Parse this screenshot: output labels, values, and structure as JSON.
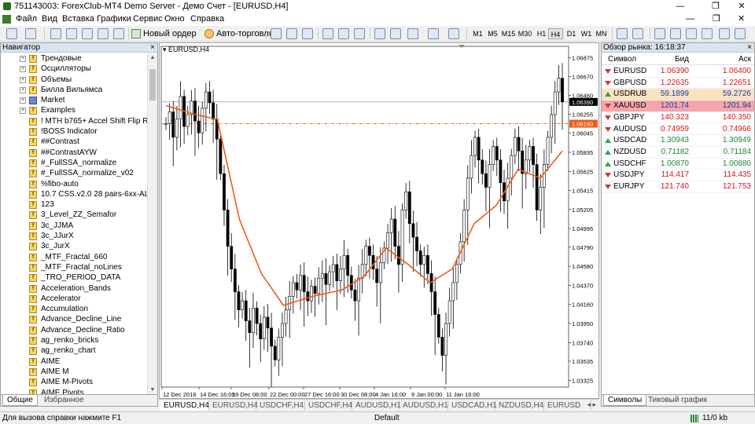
{
  "window": {
    "title": "751143003: ForexClub-MT4 Demo Server - Демо Счет - [EURUSD,H4]",
    "minimize": "—",
    "maximize": "❐",
    "close": "✕"
  },
  "menu": {
    "items": [
      "Файл",
      "Вид",
      "Вставка",
      "Графики",
      "Сервис",
      "Окно",
      "Справка"
    ],
    "mdi_minimize": "—",
    "mdi_restore": "❐",
    "mdi_close": "✕"
  },
  "toolbar": {
    "new_order": "Новый ордер",
    "auto_trading": "Авто-торговля",
    "timeframes": [
      "M1",
      "M5",
      "M15",
      "M30",
      "H1",
      "H4",
      "D1",
      "W1",
      "MN"
    ],
    "active_timeframe": "H4"
  },
  "navigator": {
    "title": "Навигатор",
    "close": "×",
    "items": [
      {
        "label": "Трендовые",
        "type": "folder"
      },
      {
        "label": "Осцилляторы",
        "type": "folder"
      },
      {
        "label": "Объемы",
        "type": "folder"
      },
      {
        "label": "Билла Вильямса",
        "type": "folder"
      },
      {
        "label": "Market",
        "type": "market"
      },
      {
        "label": "Examples",
        "type": "folder"
      },
      {
        "label": "!   MTH b765+ Accel Shift Flip Renko",
        "type": "indicator"
      },
      {
        "label": "!BOSS Indicator",
        "type": "indicator"
      },
      {
        "label": "##Contrast",
        "type": "indicator"
      },
      {
        "label": "##ContrastAYW",
        "type": "indicator"
      },
      {
        "label": "#_FullSSA_normalize",
        "type": "indicator"
      },
      {
        "label": "#_FullSSA_normalize_v02",
        "type": "indicator"
      },
      {
        "label": "%fibo-auto",
        "type": "indicator"
      },
      {
        "label": "10.7 CSS.v2.0 28 pairs-6xx-ALL",
        "type": "indicator"
      },
      {
        "label": "123",
        "type": "indicator"
      },
      {
        "label": "3_Level_ZZ_Semafor",
        "type": "indicator"
      },
      {
        "label": "3c_JJMA",
        "type": "indicator"
      },
      {
        "label": "3c_JJurX",
        "type": "indicator"
      },
      {
        "label": "3c_JurX",
        "type": "indicator"
      },
      {
        "label": "_MTF_Fractal_660",
        "type": "indicator"
      },
      {
        "label": "_MTF_Fractal_noLines",
        "type": "indicator"
      },
      {
        "label": "_TRO_PERIOD_DATA",
        "type": "indicator"
      },
      {
        "label": "Acceleration_Bands",
        "type": "indicator"
      },
      {
        "label": "Accelerator",
        "type": "indicator"
      },
      {
        "label": "Accumulation",
        "type": "indicator"
      },
      {
        "label": "Advance_Decline_Line",
        "type": "indicator"
      },
      {
        "label": "Advance_Decline_Ratio",
        "type": "indicator"
      },
      {
        "label": "ag_renko_bricks",
        "type": "indicator"
      },
      {
        "label": "ag_renko_chart",
        "type": "indicator"
      },
      {
        "label": "AIME",
        "type": "indicator"
      },
      {
        "label": "AIME M",
        "type": "indicator"
      },
      {
        "label": "AIME M-Pivots",
        "type": "indicator"
      },
      {
        "label": "AIME Pivots",
        "type": "indicator"
      }
    ],
    "tabs": [
      "Общие",
      "Избранное"
    ]
  },
  "chart": {
    "title": "EURUSD,H4",
    "bid_line_label": "1.06390",
    "ask_line_label": "1.06150",
    "price_labels": [
      "1.06875",
      "1.06670",
      "1.06460",
      "1.06255",
      "1.06045",
      "1.05835",
      "1.05625",
      "1.05415",
      "1.05205",
      "1.04995",
      "1.04790",
      "1.04580",
      "1.04370",
      "1.04160",
      "1.03950",
      "1.03740",
      "1.03535",
      "1.03325"
    ],
    "time_labels": [
      "12 Dec 2016",
      "14 Dec 16:00",
      "19 Dec 08:00",
      "22 Dec 00:00",
      "27 Dec 16:00",
      "30 Dec 08:00",
      "4 Jan 16:00",
      "9 Jan 00:00",
      "11 Jan 16:00"
    ],
    "tabs": [
      "EURUSD,H4",
      "EURUSD,H4",
      "USDCHF,H4",
      "USDCHF,H4",
      "AUDUSD,H1",
      "AUDUSD,H1",
      "USDCAD,H1",
      "NZDUSD,H4",
      "EURUSD"
    ]
  },
  "chart_data": {
    "type": "candlestick",
    "symbol": "EURUSD",
    "timeframe": "H4",
    "ylim": [
      1.0325,
      1.0695
    ],
    "closes": [
      1.0615,
      1.0628,
      1.06,
      1.062,
      1.0645,
      1.0612,
      1.0625,
      1.064,
      1.0618,
      1.0605,
      1.0632,
      1.065,
      1.0638,
      1.062,
      1.0598,
      1.056,
      1.052,
      1.048,
      1.0455,
      1.043,
      1.041,
      1.042,
      1.0398,
      1.0385,
      1.0412,
      1.0395,
      1.0378,
      1.0402,
      1.039,
      1.037,
      1.0355,
      1.038,
      1.0395,
      1.041,
      1.0425,
      1.044,
      1.0432,
      1.0448,
      1.043,
      1.042,
      1.0436,
      1.0428,
      1.0445,
      1.045,
      1.0438,
      1.0452,
      1.046,
      1.0442,
      1.0455,
      1.047,
      1.0448,
      1.0432,
      1.042,
      1.0445,
      1.046,
      1.048,
      1.047,
      1.0455,
      1.044,
      1.0462,
      1.0478,
      1.0495,
      1.051,
      1.048,
      1.046,
      1.052,
      1.054,
      1.0505,
      1.049,
      1.0475,
      1.046,
      1.047,
      1.045,
      1.043,
      1.0405,
      1.038,
      1.036,
      1.0395,
      1.042,
      1.044,
      1.046,
      1.0485,
      1.052,
      1.0555,
      1.058,
      1.06,
      1.0575,
      1.056,
      1.0545,
      1.057,
      1.059,
      1.0575,
      1.055,
      1.053,
      1.0555,
      1.058,
      1.06,
      1.0585,
      1.056,
      1.0575,
      1.059,
      1.057,
      1.052,
      1.0545,
      1.057,
      1.06,
      1.0625,
      1.065,
      1.0665,
      1.0639
    ],
    "moving_average": [
      [
        0,
        1.0635
      ],
      [
        8,
        1.0625
      ],
      [
        14,
        1.062
      ],
      [
        20,
        1.051
      ],
      [
        26,
        1.045
      ],
      [
        32,
        1.0415
      ],
      [
        40,
        1.0425
      ],
      [
        48,
        1.0432
      ],
      [
        54,
        1.0447
      ],
      [
        60,
        1.0478
      ],
      [
        66,
        1.046
      ],
      [
        72,
        1.044
      ],
      [
        78,
        1.0455
      ],
      [
        84,
        1.0505
      ],
      [
        90,
        1.0525
      ],
      [
        96,
        1.0565
      ],
      [
        102,
        1.0555
      ],
      [
        108,
        1.0585
      ]
    ],
    "ma_color": "#e85d1c",
    "candle_color": "#000000",
    "bid": 1.0639,
    "ask": 1.0615
  },
  "market_watch": {
    "title": "Обзор рынка: 16:18:37",
    "close": "×",
    "columns": [
      "Символ",
      "Бид",
      "Аск"
    ],
    "rows": [
      {
        "symbol": "EURUSD",
        "bid": "1.06390",
        "ask": "1.06400",
        "dir": "down",
        "highlight": ""
      },
      {
        "symbol": "GBPUSD",
        "bid": "1.22635",
        "ask": "1.22651",
        "dir": "down",
        "highlight": ""
      },
      {
        "symbol": "USDRUB",
        "bid": "59.1899",
        "ask": "59.2726",
        "dir": "up",
        "highlight": "#fbe3c0"
      },
      {
        "symbol": "XAUUSD",
        "bid": "1201.74",
        "ask": "1201.94",
        "dir": "down",
        "highlight": "#f5a6ab"
      },
      {
        "symbol": "GBPJPY",
        "bid": "140.323",
        "ask": "140.350",
        "dir": "down",
        "highlight": ""
      },
      {
        "symbol": "AUDUSD",
        "bid": "0.74959",
        "ask": "0.74966",
        "dir": "down",
        "highlight": ""
      },
      {
        "symbol": "USDCAD",
        "bid": "1.30943",
        "ask": "1.30949",
        "dir": "up",
        "highlight": ""
      },
      {
        "symbol": "NZDUSD",
        "bid": "0.71182",
        "ask": "0.71184",
        "dir": "up",
        "highlight": ""
      },
      {
        "symbol": "USDCHF",
        "bid": "1.00870",
        "ask": "1.00880",
        "dir": "up",
        "highlight": ""
      },
      {
        "symbol": "USDJPY",
        "bid": "114.417",
        "ask": "114.435",
        "dir": "down",
        "highlight": ""
      },
      {
        "symbol": "EURJPY",
        "bid": "121.740",
        "ask": "121.753",
        "dir": "down",
        "highlight": ""
      }
    ],
    "tabs": [
      "Символы",
      "Тиковый график"
    ]
  },
  "status": {
    "help": "Для вызова справки нажмите F1",
    "profile": "Default",
    "connection": "11/0 kb"
  },
  "colors": {
    "price_up": "#1a8a2e",
    "price_down": "#d01818",
    "bid_line": "#808080",
    "ask_line": "#e85d1c"
  }
}
